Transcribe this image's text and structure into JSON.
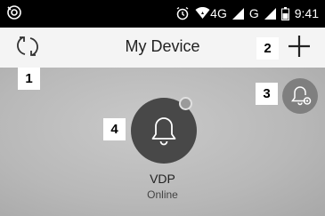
{
  "status_bar": {
    "time": "9:41",
    "network_1": "4G",
    "network_2": "G",
    "icons": [
      "notification-icon",
      "alarm-clock-icon",
      "wifi-icon",
      "signal-icon",
      "battery-icon"
    ]
  },
  "header": {
    "title": "My Device",
    "refresh_icon": "refresh-icon",
    "add_icon": "add-icon"
  },
  "annotations": [
    "1",
    "2",
    "3",
    "4"
  ],
  "device": {
    "name": "VDP",
    "status": "Online",
    "icon": "bell-icon"
  },
  "settings": {
    "icon": "bell-settings-icon"
  },
  "colors": {
    "status_bar_bg": "#000000",
    "header_bg": "#f4f4f4",
    "device_circle": "#484848",
    "settings_circle": "#7f7f7f"
  }
}
